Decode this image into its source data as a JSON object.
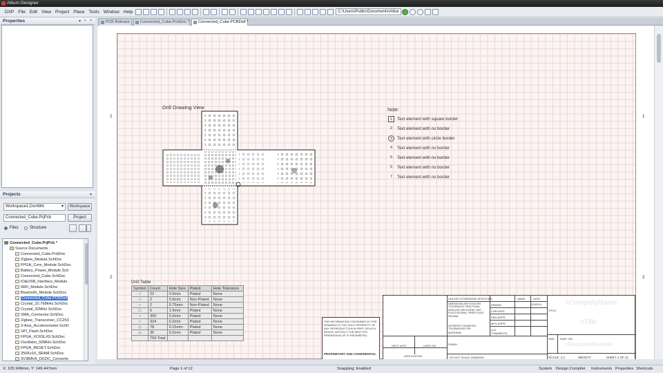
{
  "app": {
    "title": "Altium Designer"
  },
  "menu": [
    "DXP",
    "File",
    "Edit",
    "View",
    "Project",
    "Place",
    "Tools",
    "Window",
    "Help"
  ],
  "toolbar": {
    "path": "C:\\Users\\Public\\Documents\\Altiur"
  },
  "properties_panel": {
    "title": "Properties"
  },
  "projects_panel": {
    "title": "Projects",
    "workspace_value": "Workspace1.DsnWrk",
    "workspace_button": "Workspace",
    "project_value": "Connected_Cube.PrjPcb",
    "project_button": "Project",
    "view_files": "Files",
    "view_structure": "Structure",
    "tree": [
      {
        "label": "Connected_Cube.PrjPcb *",
        "level": 0
      },
      {
        "label": "Source Documents",
        "level": 1
      },
      {
        "label": "Connected_Cube.PcbDoc",
        "level": 2
      },
      {
        "label": "Zigbee_Module.SchDoc",
        "level": 2
      },
      {
        "label": "FPGA_Core_Module.SchDoc",
        "level": 2
      },
      {
        "label": "Battery_Power_Module.Sch",
        "level": 2
      },
      {
        "label": "Connected_Cube.SchDoc",
        "level": 2
      },
      {
        "label": "IO&USB_Interface_Module",
        "level": 2
      },
      {
        "label": "WiFi_Module.SchDoc",
        "level": 2
      },
      {
        "label": "Bluetooth_Module.SchDoc",
        "level": 2
      },
      {
        "label": "Connected_Cube.PCBDwf",
        "level": 2,
        "selected": true
      },
      {
        "label": "Crystal_32.768kHz.SchDoc",
        "level": 2
      },
      {
        "label": "Crystal_32MHz.SchDoc",
        "level": 2
      },
      {
        "label": "SMA_Connector.SchDoc",
        "level": 2
      },
      {
        "label": "Zigbee_Transceiver_CC253",
        "level": 2
      },
      {
        "label": "3-Axis_Accelerometer.SchD",
        "level": 2
      },
      {
        "label": "SPI_Flash.SchDoc",
        "level": 2
      },
      {
        "label": "FPGA_XC6SLX9.SchDoc",
        "level": 2
      },
      {
        "label": "Oscillator_50MHz.SchDoc",
        "level": 2
      },
      {
        "label": "FPGA_RESET.SchDoc",
        "level": 2
      },
      {
        "label": "256Kx16_SRAM.SchDoc",
        "level": 2
      },
      {
        "label": "3V3BAV6_DCDC_Converte",
        "level": 2
      }
    ]
  },
  "tabs": [
    {
      "label": "PCB Release",
      "active": false
    },
    {
      "label": "Connected_Cube.PcbDoc *",
      "active": false
    },
    {
      "label": "Connected_Cube.PCBDwf *",
      "active": true
    }
  ],
  "sheet": {
    "zones_left": [
      "1",
      "2"
    ],
    "zones_right": [
      "1",
      "2"
    ],
    "drill_drawing_title": "Drill Drawing View",
    "note_title": "Note:",
    "notes": [
      {
        "n": "1",
        "text": "Text element with square border",
        "border": "square"
      },
      {
        "n": "2",
        "text": "Text element with no border",
        "border": "none"
      },
      {
        "n": "3",
        "text": "Text element with circle border",
        "border": "circle"
      },
      {
        "n": "4",
        "text": "Text element with no border",
        "border": "none"
      },
      {
        "n": "5",
        "text": "Text element with no border",
        "border": "none"
      },
      {
        "n": "6",
        "text": "Text element with no border",
        "border": "none"
      },
      {
        "n": "7",
        "text": "Text element with no border",
        "border": "none"
      }
    ],
    "drill_table": {
      "title": "Drill Table",
      "headers": [
        "Symbol",
        "Count",
        "Hole Size",
        "Plated",
        "Hole Tolerance"
      ],
      "rows": [
        [
          "○",
          "22",
          "0.9mm",
          "Plated",
          "None"
        ],
        [
          "○",
          "2",
          "0.9mm",
          "Non-Plated",
          "None"
        ],
        [
          "○",
          "2",
          "0.75mm",
          "Non-Plated",
          "None"
        ],
        [
          "□",
          "6",
          "1.9mm",
          "Plated",
          "None"
        ],
        [
          "○",
          "300",
          "0.3mm",
          "Plated",
          "None"
        ],
        [
          "○",
          "324",
          "0.2mm",
          "Plated",
          "None"
        ],
        [
          "◇",
          "78",
          "0.15mm",
          "Plated",
          "None"
        ],
        [
          "◇",
          "35",
          "0.2mm",
          "Plated",
          "None"
        ],
        [
          "",
          "769 Total",
          "",
          "",
          ""
        ]
      ]
    },
    "title_block": {
      "proprietary_note": "THE INFORMATION CONTAINED IN THIS DRAWING IS THE SOLE PROPERTY OF . ANY REPRODUCTION IN PART OR AS A WHOLE WITHOUT THE WRITTEN PERMISSION OF IS PROHIBITED.",
      "proprietary_label": "PROPRIETARY AND CONFIDENTIAL",
      "unless": "UNLESS OTHERWISE SPECIFIED:",
      "dims": "DIMENSIONS ARE IN INCHES TOLERANCES: FRACTIONAL ANGULAR: MACH BEND TWO PLACE DECIMAL THREE PLACE DECIMAL",
      "interpret": "INTERPRET GEOMETRIC TOLERANCING PER:",
      "material": "MATERIAL",
      "finish": "FINISH",
      "next_assy": "NEXT ASSY",
      "used_on": "USED ON",
      "application": "APPLICATION",
      "do_not_scale": "DO NOT SCALE DRAWING",
      "name": "NAME",
      "date": "DATE",
      "drawn": "DRAWN",
      "drawn_date": "1/20/2014",
      "checked": "CHECKED",
      "eng_appr": "ENG APPR.",
      "mfg_appr": "MFG APPR.",
      "qa": "Q.A.",
      "comments": "COMMENTS:",
      "title_label": "TITLE:",
      "company": "=CompanyName",
      "title_value": "=Title",
      "size": "SIZE",
      "dwg_no": "DWG. NO.",
      "document_number": "=DocumentNumber",
      "scale": "SCALE: 1:1",
      "weight": "WEIGHT:",
      "sheet_of": "SHEET 1 OF 12"
    }
  },
  "status": {
    "coords": "X: 105.949mm, Y: 149.447mm",
    "page": "Page 1 of 12",
    "snapping": "Snapping: Enabled",
    "buttons": [
      "System",
      "Design Compiler",
      "Instruments",
      "Properties",
      "Shortcuts"
    ]
  }
}
